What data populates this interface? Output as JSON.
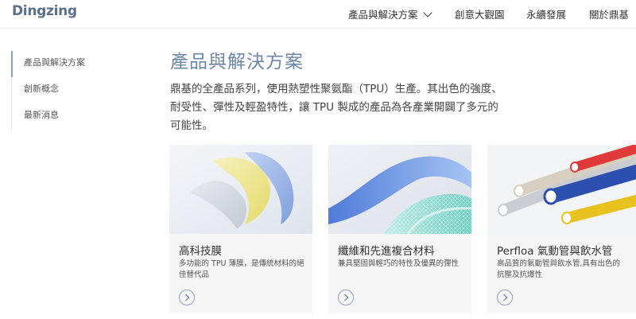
{
  "brand": {
    "logo_text": "Dingzing"
  },
  "nav": {
    "products": "產品與解決方案",
    "gallery": "創意大觀園",
    "sustainability": "永續發展",
    "about": "關於鼎基"
  },
  "sidebar": {
    "items": [
      {
        "label": "產品與解決方案",
        "active": true
      },
      {
        "label": "創新概念",
        "active": false
      },
      {
        "label": "最新消息",
        "active": false
      }
    ]
  },
  "main": {
    "title": "產品與解決方案",
    "intro": "鼎基的全產品系列，使用熱塑性聚氨酯（TPU）生產。其出色的強度、耐受性、彈性及輕盈特性，讓 TPU 製成的產品為各產業開闢了多元的可能性。"
  },
  "cards": [
    {
      "title": "高科技膜",
      "desc": "多功能的 TPU 薄膜，是傳統材料的絕佳替代品",
      "image_icon": "film-icon"
    },
    {
      "title": "纖維和先進複合材料",
      "desc": "兼具堅固與輕巧的特性及優異的彈性",
      "image_icon": "fiber-composite-icon"
    },
    {
      "title": "Perfloa 氣動管與飲水管",
      "desc": "高品質的氣動管與飲水管,具有出色的抗壓及抗爆性",
      "image_icon": "tubes-icon"
    }
  ],
  "colors": {
    "accent": "#6d86a8",
    "logo": "#5a6f8a",
    "card_bg": "#f6f6f6"
  }
}
